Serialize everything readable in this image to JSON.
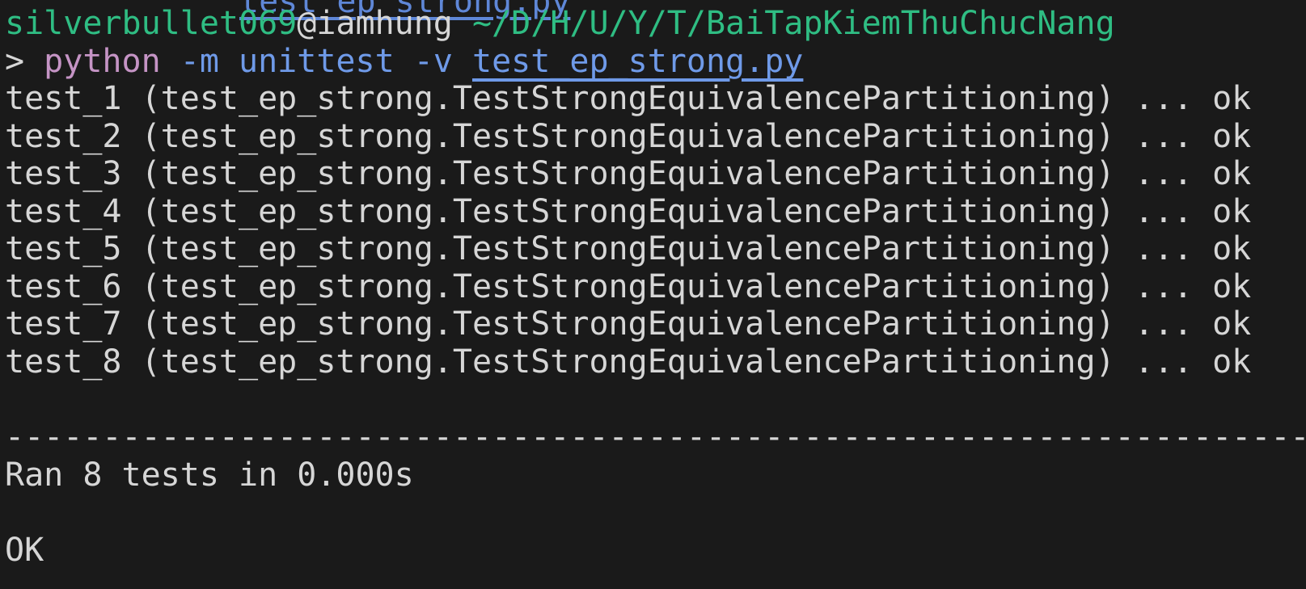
{
  "terminal": {
    "clipped_previous_command": "test_ep_strong.py",
    "prompt": {
      "user": "silverbullet069",
      "at_host": "@iamhung",
      "cwd": " ~/D/H/U/Y/T/BaiTapKiemThuChucNang"
    },
    "command": {
      "prompt_char": "> ",
      "program": "python",
      "args": " -m unittest -v ",
      "file": "test_ep_strong.py"
    },
    "results": [
      {
        "line": "test_1 (test_ep_strong.TestStrongEquivalencePartitioning) ... ok"
      },
      {
        "line": "test_2 (test_ep_strong.TestStrongEquivalencePartitioning) ... ok"
      },
      {
        "line": "test_3 (test_ep_strong.TestStrongEquivalencePartitioning) ... ok"
      },
      {
        "line": "test_4 (test_ep_strong.TestStrongEquivalencePartitioning) ... ok"
      },
      {
        "line": "test_5 (test_ep_strong.TestStrongEquivalencePartitioning) ... ok"
      },
      {
        "line": "test_6 (test_ep_strong.TestStrongEquivalencePartitioning) ... ok"
      },
      {
        "line": "test_7 (test_ep_strong.TestStrongEquivalencePartitioning) ... ok"
      },
      {
        "line": "test_8 (test_ep_strong.TestStrongEquivalencePartitioning) ... ok"
      }
    ],
    "separator": "----------------------------------------------------------------------",
    "summary": "Ran 8 tests in 0.000s",
    "status": "OK"
  },
  "colors": {
    "background": "#1a1a1a",
    "foreground": "#d6d6d6",
    "prompt_green": "#2fbd83",
    "python_purple": "#c594c5",
    "args_blue": "#6f9ae8"
  }
}
